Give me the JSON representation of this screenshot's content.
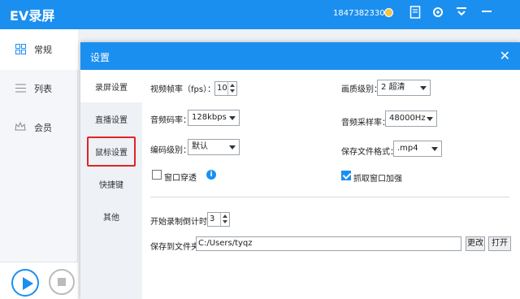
{
  "app": {
    "title": "EV录屏",
    "phone": "18473823306",
    "icons": [
      "coin-icon",
      "document-icon",
      "gear-icon",
      "menu-icon",
      "minimize-icon"
    ]
  },
  "sidebar": {
    "items": [
      {
        "label": "常规",
        "icon": "grid-icon"
      },
      {
        "label": "列表",
        "icon": "list-icon"
      },
      {
        "label": "会员",
        "icon": "crown-icon"
      }
    ]
  },
  "dialog": {
    "title": "设置",
    "nav": [
      {
        "label": "录屏设置"
      },
      {
        "label": "直播设置"
      },
      {
        "label": "鼠标设置"
      },
      {
        "label": "快捷键"
      },
      {
        "label": "其他"
      }
    ],
    "form": {
      "fps_label": "视频帧率（fps）：",
      "fps_value": "10",
      "quality_label": "画质级别：",
      "quality_value": "2 超清",
      "bitrate_label": "音频码率：",
      "bitrate_value": "128kbps",
      "samplerate_label": "音频采样率：",
      "samplerate_value": "48000Hz",
      "encode_label": "编码级别：",
      "encode_value": "默认",
      "format_label": "保存文件格式：",
      "format_value": ".mp4",
      "window_pass_label": "窗口穿透",
      "window_pass_checked": false,
      "capture_boost_label": "抓取窗口加强",
      "capture_boost_checked": true,
      "countdown_label": "开始录制倒计时：",
      "countdown_value": "3",
      "save_path_label": "保存到文件夹：",
      "save_path_value": "C:/Users/tyqz",
      "change_button": "更改",
      "open_button": "打开",
      "info_icon": "i"
    }
  },
  "colors": {
    "accent": "#1b8ff0",
    "highlight": "#e02424"
  }
}
